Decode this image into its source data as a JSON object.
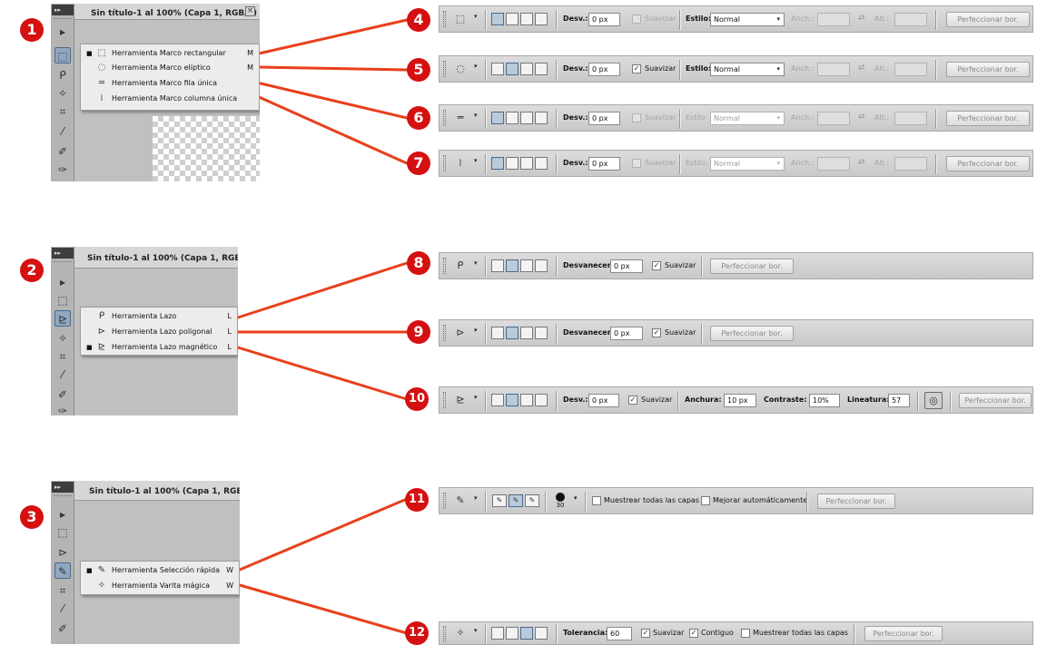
{
  "document_title": "Sin título-1 al 100% (Capa 1, RGB/8)",
  "document_title_cut_2": "Sin título-1 al 100% (Capa 1, RGB/",
  "panel_grip_label": "▸▸",
  "step_numbers": [
    "1",
    "2",
    "3",
    "4",
    "5",
    "6",
    "7",
    "8",
    "9",
    "10",
    "11",
    "12"
  ],
  "connector_color": "#e8401c",
  "badge_color": "#d51010",
  "marquee_flyout": [
    {
      "label": "Herramienta Marco rectangular",
      "key": "M",
      "icon": "rect-marquee-icon",
      "selected": true
    },
    {
      "label": "Herramienta Marco elíptico",
      "key": "M",
      "icon": "ellipse-marquee-icon",
      "selected": false
    },
    {
      "label": "Herramienta Marco fila única",
      "key": "",
      "icon": "single-row-marquee-icon",
      "selected": false
    },
    {
      "label": "Herramienta Marco columna única",
      "key": "",
      "icon": "single-column-marquee-icon",
      "selected": false
    }
  ],
  "lasso_flyout": [
    {
      "label": "Herramienta Lazo",
      "key": "L",
      "icon": "lasso-icon",
      "selected": false
    },
    {
      "label": "Herramienta Lazo poligonal",
      "key": "L",
      "icon": "polygonal-lasso-icon",
      "selected": false
    },
    {
      "label": "Herramienta Lazo magnético",
      "key": "L",
      "icon": "magnetic-lasso-icon",
      "selected": true
    }
  ],
  "quick_flyout": [
    {
      "label": "Herramienta Selección rápida",
      "key": "W",
      "icon": "quick-selection-icon",
      "selected": true
    },
    {
      "label": "Herramienta Varita mágica",
      "key": "W",
      "icon": "magic-wand-icon",
      "selected": false
    }
  ],
  "labels": {
    "desv": "Desv.:",
    "desvanecer": "Desvanecer:",
    "suavizar": "Suavizar",
    "estilo": "Estilo:",
    "anch": "Anch.:",
    "alt": "Alt.:",
    "perfeccionar": "Perfeccionar bor.",
    "anchura": "Anchura:",
    "contraste": "Contraste:",
    "lineatura": "Lineatura:",
    "muestrear": "Muestrear todas las capas",
    "mejorar": "Mejorar automáticamente",
    "tolerancia": "Tolerancia:",
    "contiguo": "Contiguo"
  },
  "values": {
    "px": "0 px",
    "estilo": "Normal",
    "anchura": "10 px",
    "contraste": "10%",
    "lineatura": "57",
    "brush_size": "30",
    "tolerancia": "60"
  },
  "icons": {
    "rect": "⬚",
    "ellipse": "◌",
    "row": "═",
    "col": "⁞",
    "lasso": "ᑭ",
    "poly": "⊳",
    "mag": "⊵",
    "quick": "✎",
    "wand": "✧",
    "move": "▸",
    "crop": "⌗",
    "eyedrop": "⁄",
    "heal": "✐",
    "brush": "✑",
    "check": "✓",
    "caret": "▾",
    "swap": "⇄",
    "close": "×",
    "bullet": "■",
    "pressure": "◎"
  }
}
